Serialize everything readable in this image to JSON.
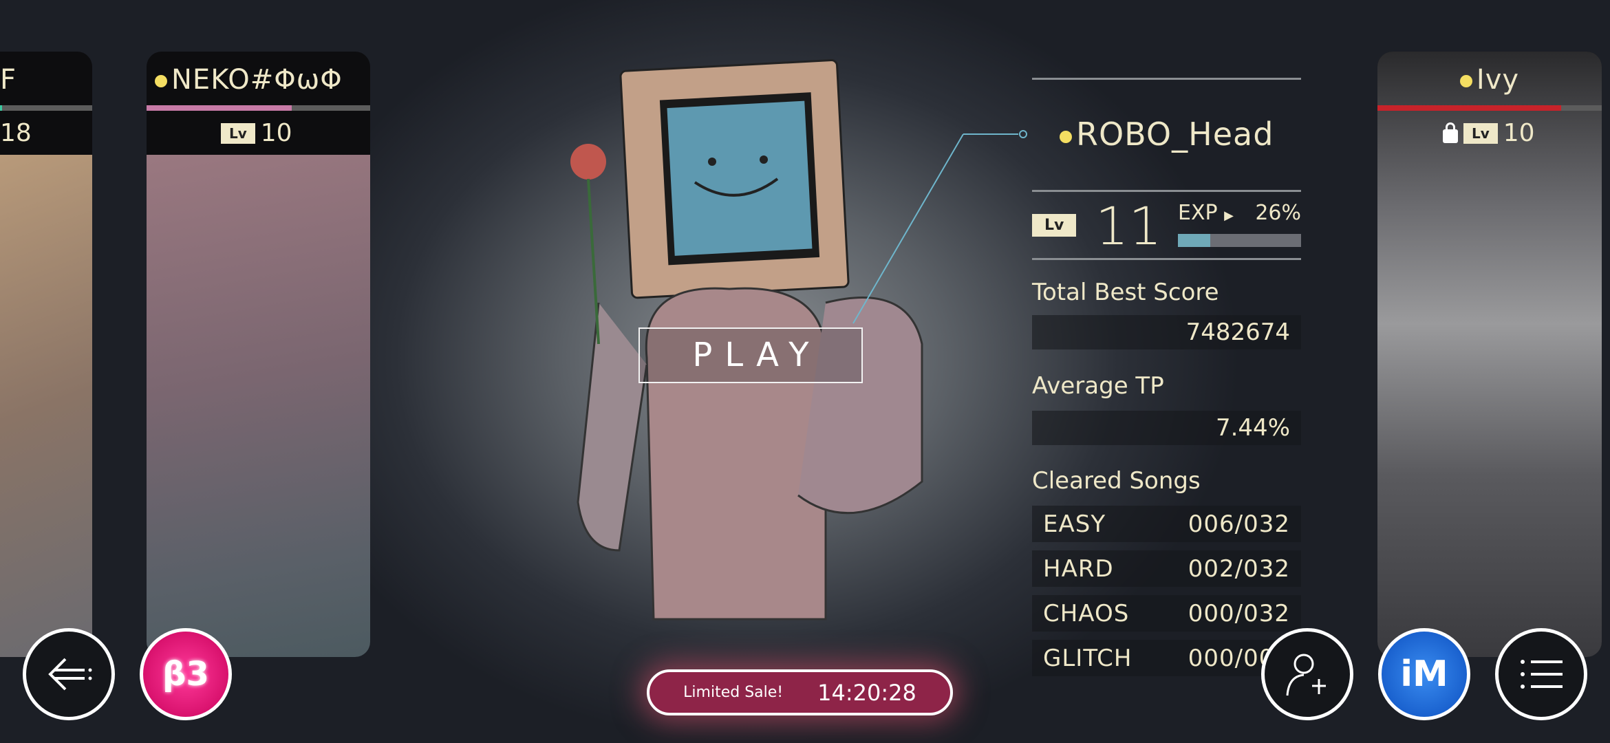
{
  "cards": [
    {
      "name": "F",
      "level": "18",
      "bar_color": "#3cc7a0",
      "bar_pct": 2
    },
    {
      "name": "NEKO#ΦωΦ",
      "level": "10",
      "bar_color": "#c77aa6",
      "bar_pct": 65
    },
    {
      "name": "Ivy",
      "level": "10",
      "bar_color": "#c8232a",
      "bar_pct": 82,
      "locked": true
    }
  ],
  "center": {
    "play_label": "PLAY"
  },
  "profile": {
    "name": "ROBO_Head",
    "lv_tag": "Lv",
    "level": "11",
    "exp_label": "EXP",
    "exp_pct_text": "26%",
    "exp_pct": 26,
    "total_best_score_label": "Total Best Score",
    "total_best_score": "7482674",
    "average_tp_label": "Average TP",
    "average_tp": "7.44%",
    "cleared_songs_label": "Cleared Songs",
    "cleared": [
      {
        "difficulty": "EASY",
        "value": "006/032"
      },
      {
        "difficulty": "HARD",
        "value": "002/032"
      },
      {
        "difficulty": "CHAOS",
        "value": "000/032"
      },
      {
        "difficulty": "GLITCH",
        "value": "000/000"
      }
    ]
  },
  "sale": {
    "label": "Limited Sale!",
    "timer": "14:20:28"
  },
  "buttons": {
    "back": "back-icon",
    "b3": "β3",
    "add_friend": "add-friend-icon",
    "im": "iM",
    "menu": "menu-icon"
  },
  "colors": {
    "accent_cream": "#efe8c8",
    "exp_fill": "#6fa9b8",
    "sale": "#8e2448",
    "b3": "#e0106e",
    "im": "#1a6fe0"
  }
}
